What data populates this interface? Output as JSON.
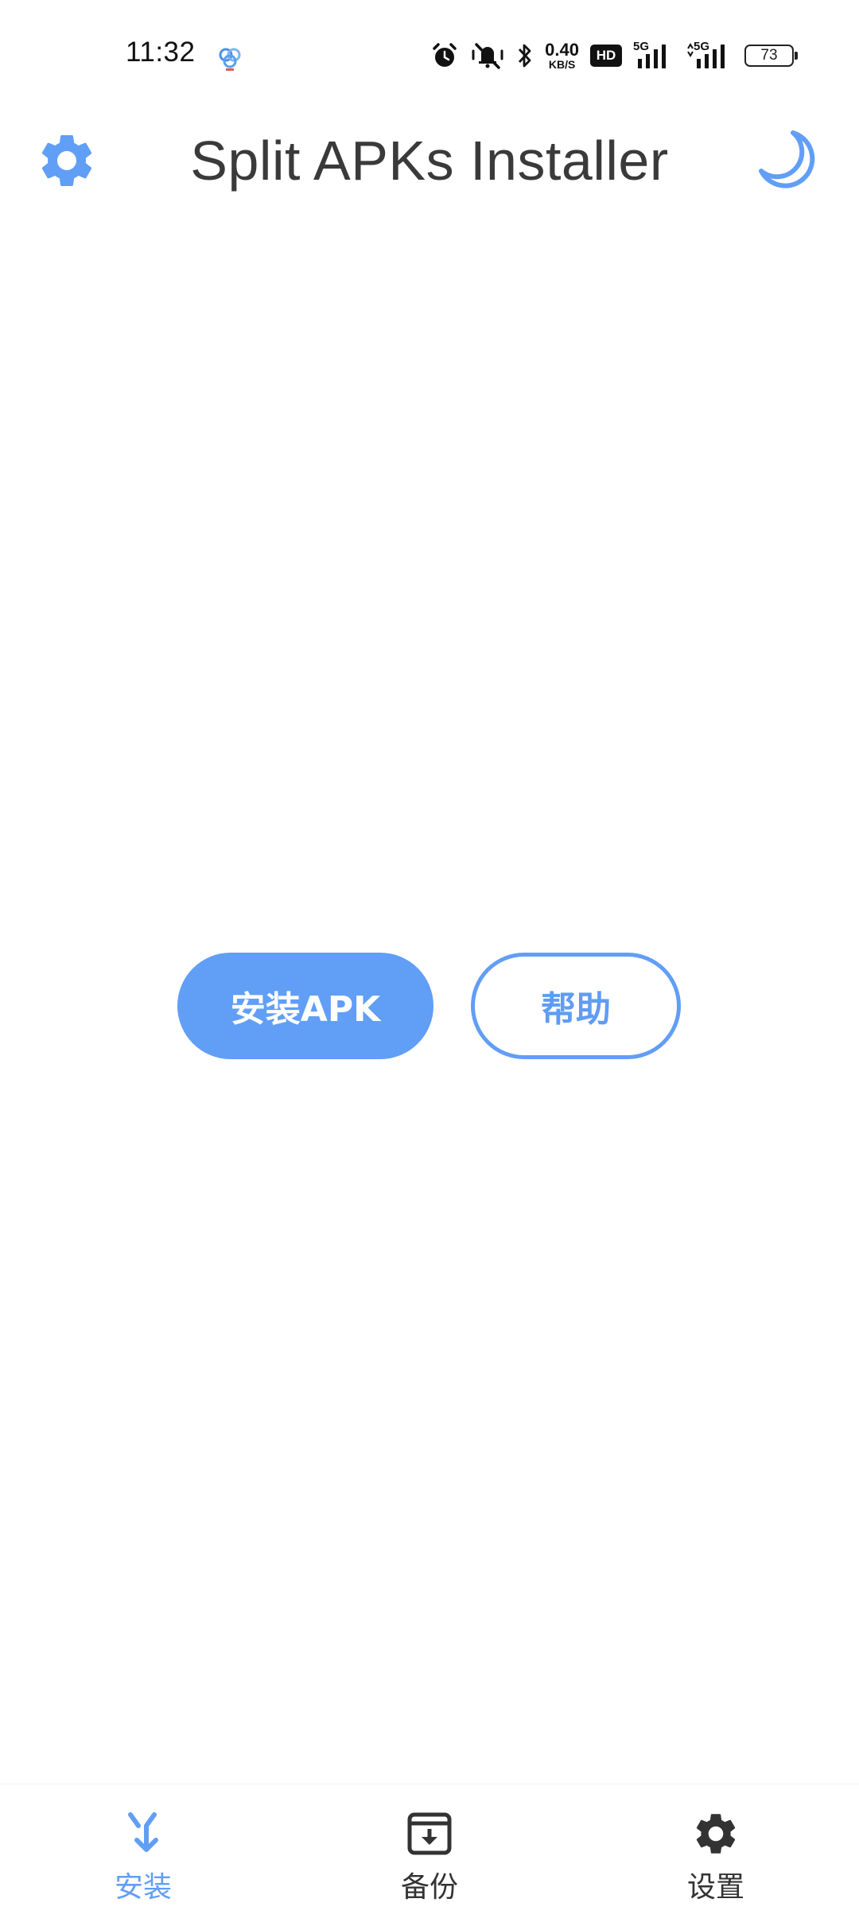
{
  "colors": {
    "accent": "#619ef6",
    "title_text": "#3a3a3a",
    "nav_inactive": "#333333",
    "background": "#ffffff"
  },
  "status_bar": {
    "time": "11:32",
    "net_speed_value": "0.40",
    "net_speed_unit": "KB/S",
    "hd_badge": "HD",
    "signal_1_label": "5G",
    "signal_2_label": "5G",
    "battery_level": "73",
    "icons": [
      "app-notification-icon",
      "alarm-icon",
      "silent-mode-icon",
      "bluetooth-icon",
      "hd-voice-icon",
      "signal-5g-icon",
      "signal-5g-icon",
      "battery-icon"
    ]
  },
  "app_bar": {
    "title": "Split APKs Installer",
    "left_icon": "gear-icon",
    "right_icon": "moon-icon"
  },
  "main": {
    "install_button_label": "安装APK",
    "help_button_label": "帮助"
  },
  "bottom_nav": {
    "items": [
      {
        "label": "安装",
        "icon": "install-icon",
        "active": true
      },
      {
        "label": "备份",
        "icon": "archive-icon",
        "active": false
      },
      {
        "label": "设置",
        "icon": "gear-icon",
        "active": false
      }
    ]
  }
}
